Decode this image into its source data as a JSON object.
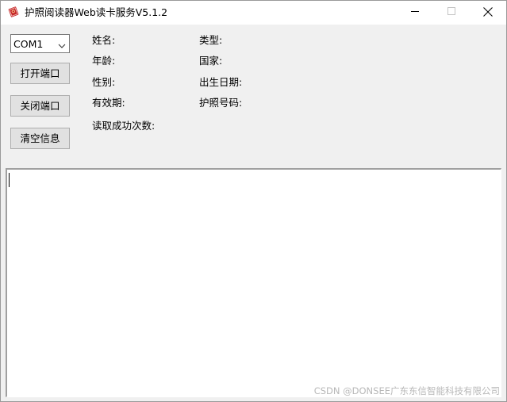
{
  "window": {
    "title": "护照阅读器Web读卡服务V5.1.2",
    "app_icon": "passport-reader-icon",
    "controls": {
      "minimize": "minimize-icon",
      "maximize": "maximize-icon",
      "close": "close-icon"
    }
  },
  "port": {
    "selected": "COM1",
    "open_label": "打开端口",
    "close_label": "关闭端口",
    "clear_label": "清空信息"
  },
  "fields": {
    "name": "姓名:",
    "type": "类型:",
    "age": "年龄:",
    "country": "国家:",
    "gender": "性别:",
    "birth_date": "出生日期:",
    "validity": "有效期:",
    "passport_no": "护照号码:",
    "read_success_count": "读取成功次数:"
  },
  "output": {
    "text": ""
  },
  "watermark": "CSDN @DONSEE广东东信智能科技有限公司",
  "colors": {
    "icon_red": "#c62828",
    "window_bg": "#f0f0f0",
    "button_bg": "#e1e1e1"
  }
}
